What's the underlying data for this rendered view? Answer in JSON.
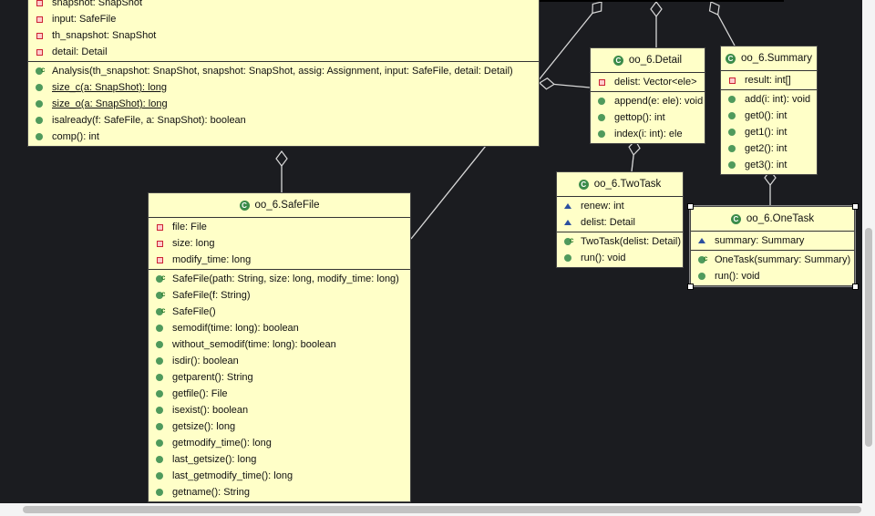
{
  "diagram": {
    "classes": [
      {
        "id": "analysis",
        "title": "",
        "selected": false,
        "fields": [
          {
            "vis": "private",
            "text": "snapshot: SnapShot"
          },
          {
            "vis": "private",
            "text": "input: SafeFile"
          },
          {
            "vis": "private",
            "text": "th_snapshot: SnapShot"
          },
          {
            "vis": "private",
            "text": "detail: Detail"
          }
        ],
        "methods": [
          {
            "kind": "ctor",
            "text": "Analysis(th_snapshot: SnapShot, snapshot: SnapShot, assig: Assignment, input: SafeFile, detail: Detail)"
          },
          {
            "kind": "static",
            "text": "size_c(a: SnapShot): long"
          },
          {
            "kind": "static",
            "text": "size_o(a: SnapShot): long"
          },
          {
            "kind": "public",
            "text": "isalready(f: SafeFile, a: SnapShot): boolean"
          },
          {
            "kind": "public",
            "text": "comp(): int"
          }
        ]
      },
      {
        "id": "safefile",
        "title": "oo_6.SafeFile",
        "selected": false,
        "fields": [
          {
            "vis": "private",
            "text": "file: File"
          },
          {
            "vis": "private",
            "text": "size: long"
          },
          {
            "vis": "private",
            "text": "modify_time: long"
          }
        ],
        "methods": [
          {
            "kind": "ctor",
            "text": "SafeFile(path: String, size: long, modify_time: long)"
          },
          {
            "kind": "ctor",
            "text": "SafeFile(f: String)"
          },
          {
            "kind": "ctor",
            "text": "SafeFile()"
          },
          {
            "kind": "public",
            "text": "semodif(time: long): boolean"
          },
          {
            "kind": "public",
            "text": "without_semodif(time: long): boolean"
          },
          {
            "kind": "public",
            "text": "isdir(): boolean"
          },
          {
            "kind": "public",
            "text": "getparent(): String"
          },
          {
            "kind": "public",
            "text": "getfile(): File"
          },
          {
            "kind": "public",
            "text": "isexist(): boolean"
          },
          {
            "kind": "public",
            "text": "getsize(): long"
          },
          {
            "kind": "public",
            "text": "getmodify_time(): long"
          },
          {
            "kind": "public",
            "text": "last_getsize(): long"
          },
          {
            "kind": "public",
            "text": "last_getmodify_time(): long"
          },
          {
            "kind": "public",
            "text": "getname(): String"
          }
        ]
      },
      {
        "id": "detail",
        "title": "oo_6.Detail",
        "selected": false,
        "fields": [
          {
            "vis": "private",
            "text": "delist: Vector<ele>"
          }
        ],
        "methods": [
          {
            "kind": "public",
            "text": "append(e: ele): void"
          },
          {
            "kind": "public",
            "text": "gettop(): int"
          },
          {
            "kind": "public",
            "text": "index(i: int): ele"
          }
        ]
      },
      {
        "id": "summary",
        "title": "oo_6.Summary",
        "selected": false,
        "fields": [
          {
            "vis": "private",
            "text": "result: int[]"
          }
        ],
        "methods": [
          {
            "kind": "public",
            "text": "add(i: int): void"
          },
          {
            "kind": "public",
            "text": "get0(): int"
          },
          {
            "kind": "public",
            "text": "get1(): int"
          },
          {
            "kind": "public",
            "text": "get2(): int"
          },
          {
            "kind": "public",
            "text": "get3(): int"
          }
        ]
      },
      {
        "id": "twotask",
        "title": "oo_6.TwoTask",
        "selected": false,
        "fields": [
          {
            "vis": "package",
            "text": "renew: int"
          },
          {
            "vis": "package",
            "text": "delist: Detail"
          }
        ],
        "methods": [
          {
            "kind": "ctor",
            "text": "TwoTask(delist: Detail)"
          },
          {
            "kind": "public",
            "text": "run(): void"
          }
        ]
      },
      {
        "id": "onetask",
        "title": "oo_6.OneTask",
        "selected": true,
        "fields": [
          {
            "vis": "package",
            "text": "summary: Summary"
          }
        ],
        "methods": [
          {
            "kind": "ctor",
            "text": "OneTask(summary: Summary)"
          },
          {
            "kind": "public",
            "text": "run(): void"
          }
        ]
      }
    ],
    "relations": [
      {
        "type": "aggregation",
        "whole": "analysis",
        "part": "safefile"
      },
      {
        "type": "aggregation",
        "whole": "analysis",
        "part": "detail"
      },
      {
        "type": "aggregation",
        "whole": "detail",
        "part": "twotask"
      },
      {
        "type": "aggregation",
        "whole": "summary",
        "part": "onetask"
      }
    ],
    "colors": {
      "canvas": "#1b1c20",
      "class_fill": "#ffffc8",
      "line": "#d8d8d8"
    }
  }
}
